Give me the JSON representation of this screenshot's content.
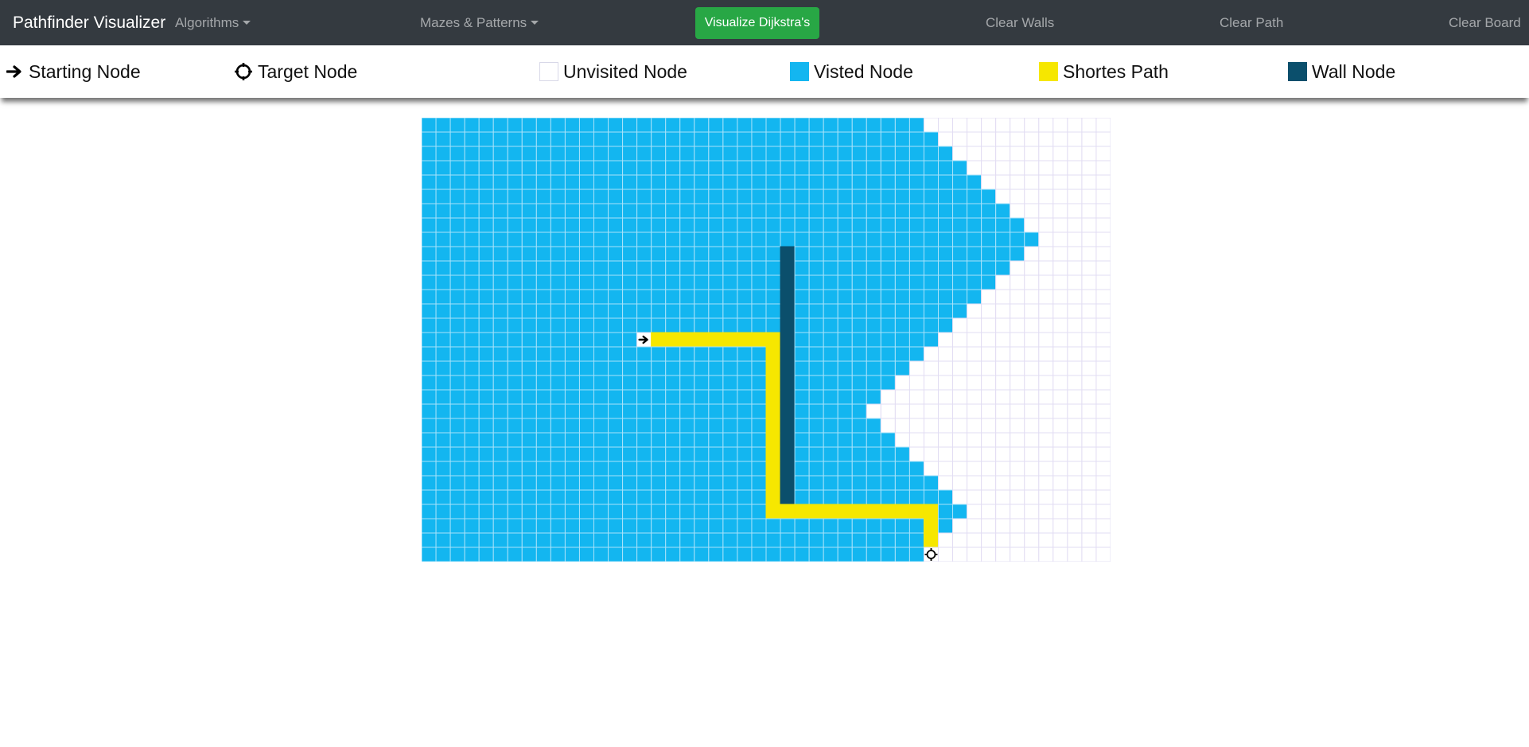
{
  "navbar": {
    "brand": "Pathfinder Visualizer",
    "algorithms_label": "Algorithms",
    "mazes_label": "Mazes & Patterns",
    "visualize_label": "Visualize Dijkstra's",
    "clear_walls_label": "Clear Walls",
    "clear_path_label": "Clear Path",
    "clear_board_label": "Clear Board"
  },
  "legend": {
    "start": "Starting Node",
    "target": "Target Node",
    "unvisited": "Unvisited Node",
    "visited": "Visted Node",
    "path": "Shortes Path",
    "wall": "Wall Node"
  },
  "colors": {
    "navbar": "#343a40",
    "visualize_button": "#28a745",
    "visited": "#13b6f0",
    "unvisited": "#ffffff",
    "path": "#f6e700",
    "wall": "#0b4f6c",
    "grid_line_visited": "#a7e2fa",
    "grid_line_unvisited": "#e2ddf3"
  },
  "grid": {
    "rows": 31,
    "cols": 48,
    "start": [
      15,
      15
    ],
    "target": [
      30,
      35
    ],
    "walls": {
      "col": 25,
      "rows": [
        9,
        26
      ]
    },
    "visited_extent_by_row": [
      34,
      35,
      36,
      37,
      38,
      39,
      40,
      41,
      42,
      41,
      40,
      39,
      38,
      37,
      36,
      35,
      34,
      33,
      32,
      31,
      30,
      31,
      32,
      33,
      34,
      35,
      36,
      37,
      36,
      35,
      34
    ],
    "path": [
      [
        15,
        16
      ],
      [
        15,
        17
      ],
      [
        15,
        18
      ],
      [
        15,
        19
      ],
      [
        15,
        20
      ],
      [
        15,
        21
      ],
      [
        15,
        22
      ],
      [
        15,
        23
      ],
      [
        15,
        24
      ],
      [
        16,
        24
      ],
      [
        17,
        24
      ],
      [
        18,
        24
      ],
      [
        19,
        24
      ],
      [
        20,
        24
      ],
      [
        21,
        24
      ],
      [
        22,
        24
      ],
      [
        23,
        24
      ],
      [
        24,
        24
      ],
      [
        25,
        24
      ],
      [
        26,
        24
      ],
      [
        27,
        24
      ],
      [
        27,
        25
      ],
      [
        27,
        26
      ],
      [
        27,
        27
      ],
      [
        27,
        28
      ],
      [
        27,
        29
      ],
      [
        27,
        30
      ],
      [
        27,
        31
      ],
      [
        27,
        32
      ],
      [
        27,
        33
      ],
      [
        27,
        34
      ],
      [
        27,
        35
      ],
      [
        28,
        35
      ],
      [
        29,
        35
      ]
    ],
    "icons": {
      "start": "arrow-right-icon",
      "target": "crosshair-icon"
    }
  }
}
